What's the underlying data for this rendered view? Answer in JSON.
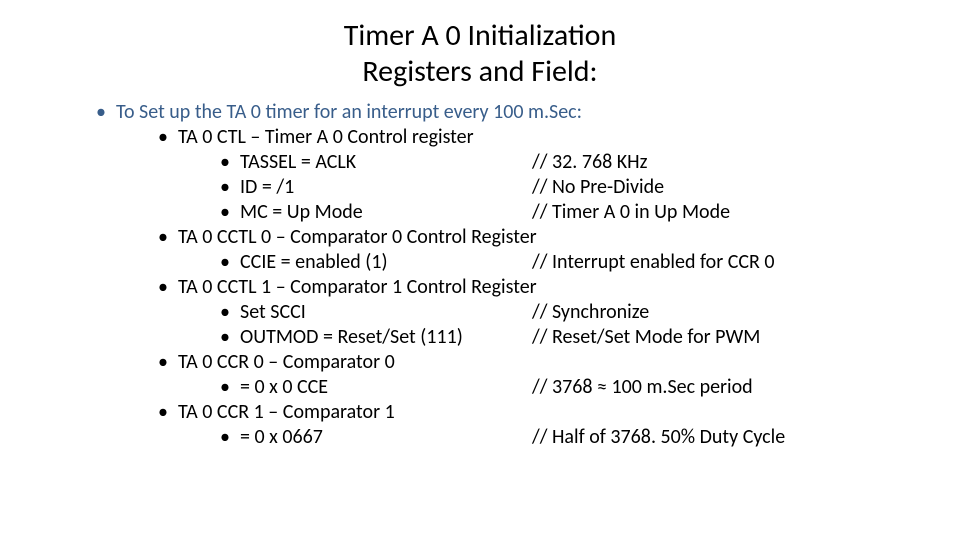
{
  "title_line1": "Timer A 0 Initialization",
  "title_line2": "Registers and Field:",
  "intro": "To Set up the TA 0 timer for an interrupt every 100 m.Sec:",
  "regs": [
    {
      "name": "TA 0 CTL – Timer A 0 Control register",
      "fields": [
        {
          "setting": "TASSEL = ACLK",
          "comment": "// 32. 768 KHz"
        },
        {
          "setting": "ID = /1",
          "comment": "// No Pre-Divide"
        },
        {
          "setting": "MC = Up Mode",
          "comment": "// Timer A 0 in Up Mode"
        }
      ]
    },
    {
      "name": "TA 0 CCTL 0 – Comparator 0 Control Register",
      "fields": [
        {
          "setting": "CCIE = enabled (1)",
          "comment": "// Interrupt enabled for CCR 0"
        }
      ]
    },
    {
      "name": "TA 0 CCTL 1 – Comparator 1 Control Register",
      "fields": [
        {
          "setting": "Set SCCI",
          "comment": "// Synchronize"
        },
        {
          "setting": "OUTMOD = Reset/Set (111)",
          "comment": "// Reset/Set Mode for PWM"
        }
      ]
    },
    {
      "name": "TA 0 CCR 0 – Comparator 0",
      "fields": [
        {
          "setting": "= 0 x 0 CCE",
          "comment": "// 3768 ≈ 100 m.Sec period"
        }
      ]
    },
    {
      "name": "TA 0 CCR 1 – Comparator 1",
      "fields": [
        {
          "setting": "= 0 x 0667",
          "comment": "// Half of 3768. 50% Duty Cycle"
        }
      ]
    }
  ]
}
